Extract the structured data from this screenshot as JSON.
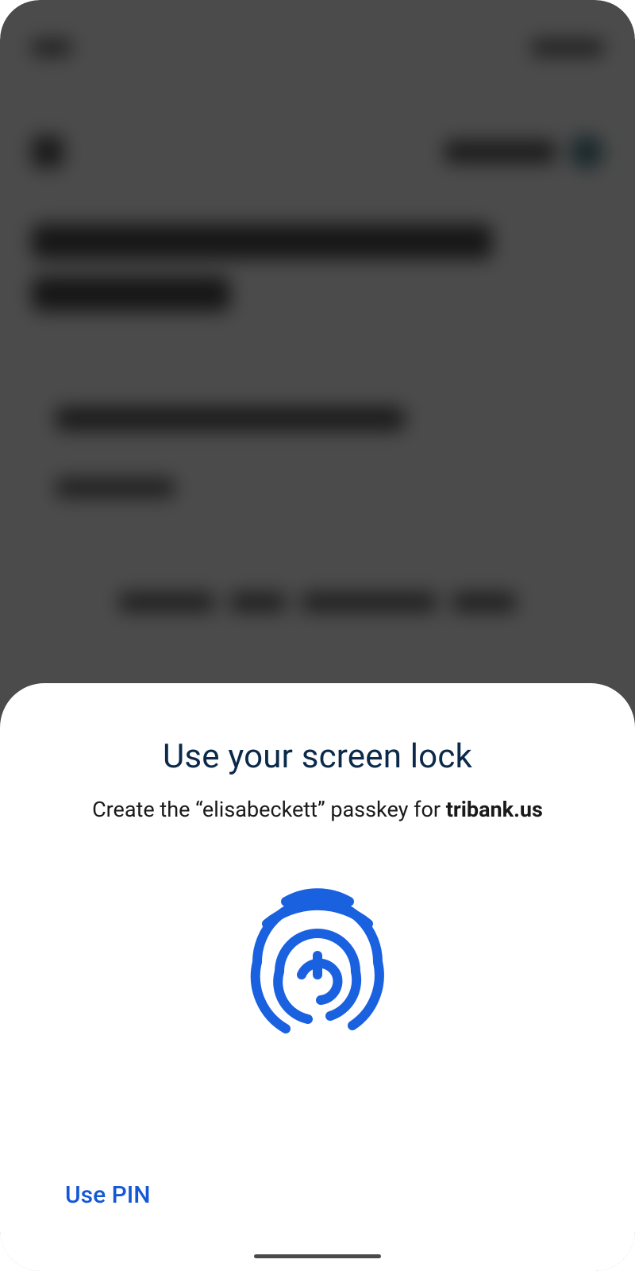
{
  "sheet": {
    "title": "Use your screen lock",
    "subtitle_prefix": "Create the “",
    "username": "elisabeckett",
    "subtitle_mid": "” passkey for ",
    "domain": "tribank.us",
    "use_pin_label": "Use PIN"
  },
  "icons": {
    "fingerprint": "fingerprint-icon"
  },
  "colors": {
    "accent_blue": "#1558d6",
    "title_navy": "#0b2a4a",
    "fingerprint_blue": "#1a61e0"
  }
}
